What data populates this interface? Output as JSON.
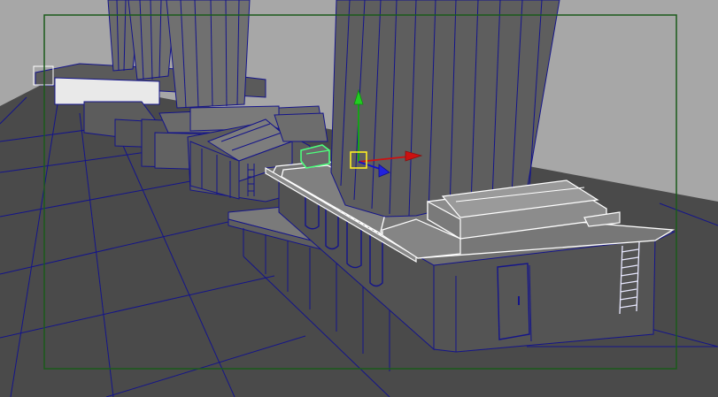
{
  "viewport": {
    "background_color": "#a7a7a7",
    "mode": "wireframe-on-shaded",
    "wireframe_color": "#14148a",
    "selection_color": "#ffffff",
    "resolution_gate_color": "#1a5a1a"
  },
  "manipulator": {
    "tool": "move-tool",
    "axis_x_color": "#cc1111",
    "axis_y_color": "#11aa11",
    "axis_z_color": "#1111cc",
    "center_color": "#ffee22"
  },
  "highlight": {
    "preselect_color": "#4cff7c"
  },
  "icons": [
    "move-manipulator-icon",
    "ladder-icon",
    "door-icon"
  ]
}
